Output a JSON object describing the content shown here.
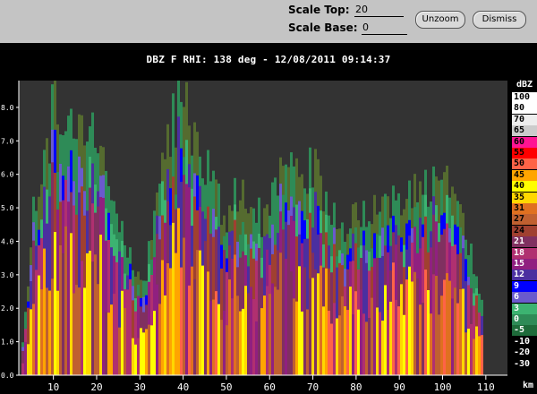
{
  "toolbar": {
    "scale_top_label": "Scale Top:",
    "scale_top_value": "20",
    "scale_base_label": "Scale Base:",
    "scale_base_value": "0",
    "unzoom_label": "Unzoom",
    "dismiss_label": "Dismiss"
  },
  "title": "DBZ F  RHI: 138 deg  -  12/08/2011 09:14:37",
  "legend": {
    "unit": "dBZ",
    "entries": [
      {
        "label": "100",
        "color": "#ffffff",
        "text": "#000000"
      },
      {
        "label": "80",
        "color": "#ffffff",
        "text": "#000000"
      },
      {
        "label": "70",
        "color": "#eeeeee",
        "text": "#000000"
      },
      {
        "label": "65",
        "color": "#cccccc",
        "text": "#000000"
      },
      {
        "label": "60",
        "color": "#ff1493",
        "text": "#000000"
      },
      {
        "label": "55",
        "color": "#ff0000",
        "text": "#000000"
      },
      {
        "label": "50",
        "color": "#ff6347",
        "text": "#000000"
      },
      {
        "label": "45",
        "color": "#ffa500",
        "text": "#000000"
      },
      {
        "label": "40",
        "color": "#ffff00",
        "text": "#000000"
      },
      {
        "label": "35",
        "color": "#ffd700",
        "text": "#000000"
      },
      {
        "label": "31",
        "color": "#e07020",
        "text": "#000000"
      },
      {
        "label": "27",
        "color": "#c06030",
        "text": "#000000"
      },
      {
        "label": "24",
        "color": "#a04030",
        "text": "#000000"
      },
      {
        "label": "21",
        "color": "#803060",
        "text": "#ffffff"
      },
      {
        "label": "18",
        "color": "#b03070",
        "text": "#ffffff"
      },
      {
        "label": "15",
        "color": "#902080",
        "text": "#ffffff"
      },
      {
        "label": "12",
        "color": "#4b2fa0",
        "text": "#ffffff"
      },
      {
        "label": "9",
        "color": "#0000ff",
        "text": "#ffffff"
      },
      {
        "label": "6",
        "color": "#6a5acd",
        "text": "#ffffff"
      },
      {
        "label": "3",
        "color": "#3cb371",
        "text": "#ffffff"
      },
      {
        "label": "0",
        "color": "#2e8b57",
        "text": "#ffffff"
      },
      {
        "label": "-5",
        "color": "#1e6b3a",
        "text": "#ffffff"
      },
      {
        "label": "-10",
        "color": "#000000",
        "text": "#ffffff"
      },
      {
        "label": "-20",
        "color": "#000000",
        "text": "#ffffff"
      },
      {
        "label": "-30",
        "color": "#000000",
        "text": "#ffffff"
      }
    ]
  },
  "chart_data": {
    "type": "heatmap",
    "title": "DBZ F  RHI: 138 deg  -  12/08/2011 09:14:37",
    "x_unit": "km",
    "x_ticks": [
      "10",
      "20",
      "30",
      "40",
      "50",
      "60",
      "70",
      "80",
      "90",
      "100",
      "110"
    ],
    "y_ticks": [
      "0.0",
      "1.0",
      "2.0",
      "3.0",
      "4.0",
      "5.0",
      "6.0",
      "7.0",
      "8.0"
    ],
    "xlim": [
      2,
      115
    ],
    "ylim": [
      0,
      8.8
    ],
    "echo_top_profile_km": [
      [
        5,
        4.8
      ],
      [
        8,
        6.6
      ],
      [
        10,
        8.5
      ],
      [
        13,
        8.2
      ],
      [
        16,
        7.0
      ],
      [
        19,
        7.8
      ],
      [
        22,
        6.2
      ],
      [
        25,
        4.5
      ],
      [
        28,
        3.6
      ],
      [
        31,
        3.0
      ],
      [
        34,
        6.0
      ],
      [
        37,
        7.6
      ],
      [
        40,
        8.7
      ],
      [
        43,
        7.0
      ],
      [
        46,
        6.0
      ],
      [
        49,
        4.8
      ],
      [
        52,
        5.6
      ],
      [
        55,
        5.2
      ],
      [
        58,
        4.8
      ],
      [
        61,
        5.8
      ],
      [
        64,
        6.4
      ],
      [
        67,
        6.0
      ],
      [
        70,
        6.6
      ],
      [
        73,
        5.4
      ],
      [
        76,
        4.6
      ],
      [
        79,
        4.8
      ],
      [
        82,
        5.2
      ],
      [
        85,
        5.4
      ],
      [
        88,
        5.3
      ],
      [
        91,
        5.4
      ],
      [
        94,
        5.6
      ],
      [
        97,
        6.0
      ],
      [
        100,
        6.2
      ],
      [
        103,
        5.8
      ],
      [
        106,
        4.0
      ],
      [
        109,
        2.2
      ]
    ],
    "grid": false,
    "legend_position": "right"
  }
}
